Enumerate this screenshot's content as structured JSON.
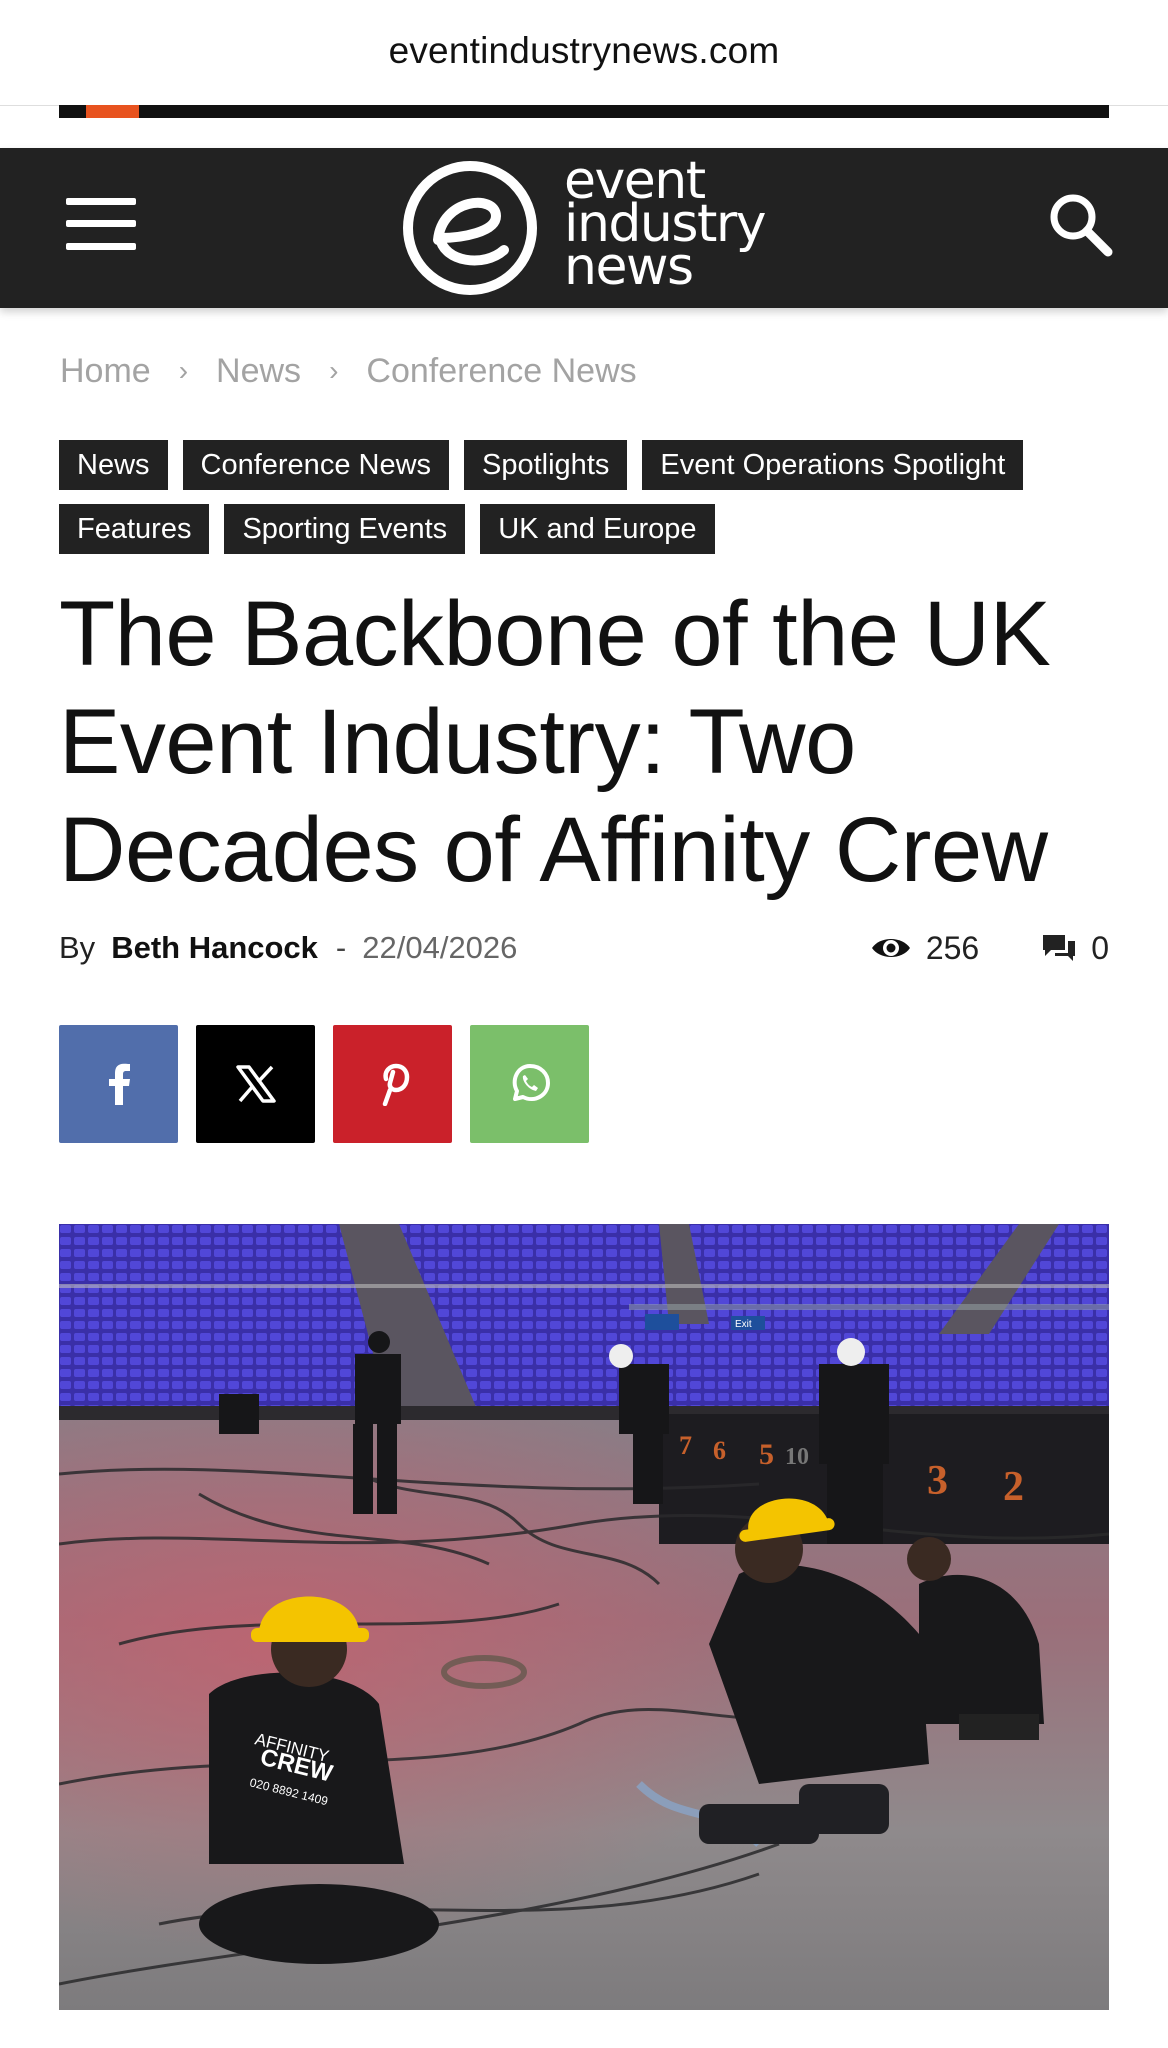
{
  "browser": {
    "url": "eventindustrynews.com"
  },
  "reading_progress": 0.05,
  "colors": {
    "header_bg": "#222222",
    "progress_accent": "#e8531f",
    "facebook": "#516eab",
    "x": "#000000",
    "pinterest": "#ca212a",
    "whatsapp": "#7bbf6a"
  },
  "header": {
    "menu_icon": "hamburger-icon",
    "search_icon": "search-icon",
    "logo_lines": [
      "event",
      "industry",
      "news"
    ]
  },
  "breadcrumb": {
    "items": [
      "Home",
      "News",
      "Conference News"
    ],
    "separator": "›"
  },
  "tags": [
    "News",
    "Conference News",
    "Spotlights",
    "Event Operations Spotlight",
    "Features",
    "Sporting Events",
    "UK and Europe"
  ],
  "article": {
    "title": "The Backbone of the UK Event Industry: Two Decades of Affinity Crew",
    "by_label": "By",
    "author": "Beth Hancock",
    "dash": "-",
    "date": "22/04/2026",
    "views": "256",
    "comments": "0"
  },
  "share": {
    "buttons": [
      {
        "network": "facebook",
        "icon": "facebook-icon"
      },
      {
        "network": "x",
        "icon": "x-icon"
      },
      {
        "network": "pinterest",
        "icon": "pinterest-icon"
      },
      {
        "network": "whatsapp",
        "icon": "whatsapp-icon"
      }
    ]
  },
  "hero_image": {
    "seat_numbers": [
      "7",
      "6",
      "5",
      "10",
      "3",
      "2"
    ],
    "shirt_brand": [
      "AFFINITY",
      "CREW"
    ],
    "shirt_phone": "020 8892 1409",
    "signs": [
      "Exit"
    ]
  }
}
